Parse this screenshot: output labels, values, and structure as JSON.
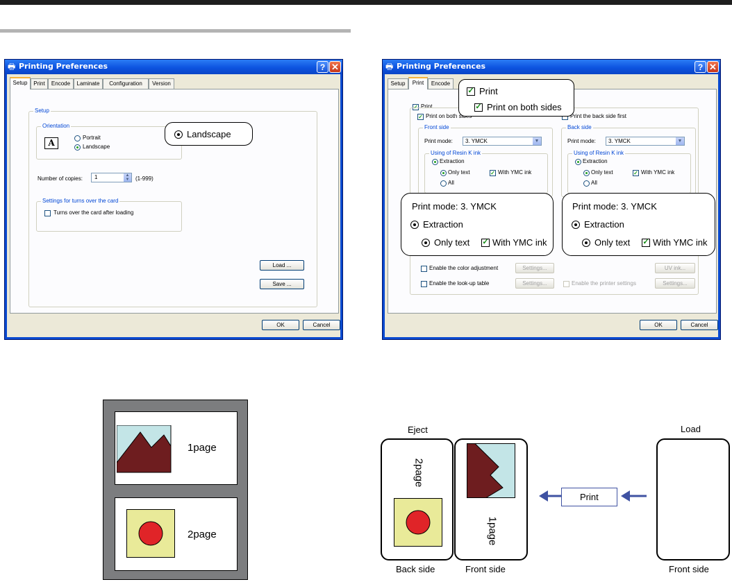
{
  "dialog": {
    "title": "Printing Preferences",
    "help_glyph": "?",
    "close_glyph": "✕",
    "tabs": [
      "Setup",
      "Print",
      "Encode",
      "Laminate",
      "Configuration",
      "Version"
    ],
    "ok_label": "OK",
    "cancel_label": "Cancel"
  },
  "setup_tab": {
    "group_setup": "Setup",
    "group_orientation": "Orientation",
    "orientation_icon": "A",
    "portrait": "Portrait",
    "landscape": "Landscape",
    "copies_label": "Number of copies:",
    "copies_value": "1",
    "copies_range": "(1-999)",
    "group_turns": "Settings for turns over the card",
    "turns_checkbox": "Turns over the card after loading",
    "load_button": "Load ...",
    "save_button": "Save ..."
  },
  "print_tab": {
    "print_checkbox": "Print",
    "print_both": "Print on both sides",
    "print_back_first": "Print the back side first",
    "front_side": "Front side",
    "back_side": "Back side",
    "print_mode_label": "Print mode:",
    "print_mode_value": "3. YMCK",
    "resin_group": "Using of Resin K ink",
    "extraction": "Extraction",
    "only_text": "Only text",
    "with_ymc": "With YMC ink",
    "all": "All",
    "color_adjust": "Enable the color adjustment",
    "lookup": "Enable the look-up table",
    "printer_settings": "Enable the printer settings",
    "settings_button": "Settings...",
    "uv_button": "UV ink..."
  },
  "callouts": {
    "landscape": "Landscape",
    "print": "Print",
    "print_both": "Print on both sides",
    "print_mode": "Print mode:  3. YMCK",
    "extraction": "Extraction",
    "only_text": "Only text",
    "with_ymc": "With YMC ink"
  },
  "diagram": {
    "page1": "1page",
    "page2": "2page",
    "eject": "Eject",
    "load": "Load",
    "print": "Print",
    "back_side": "Back side",
    "front_side": "Front side"
  },
  "colors": {
    "sky": "#c3e5e7",
    "mountain": "#6e1d1f",
    "circle": "#e02428",
    "card_yellow": "#e9ea99",
    "arrow_blue": "#3f52a2",
    "frame_gray": "#7c7d7f"
  }
}
